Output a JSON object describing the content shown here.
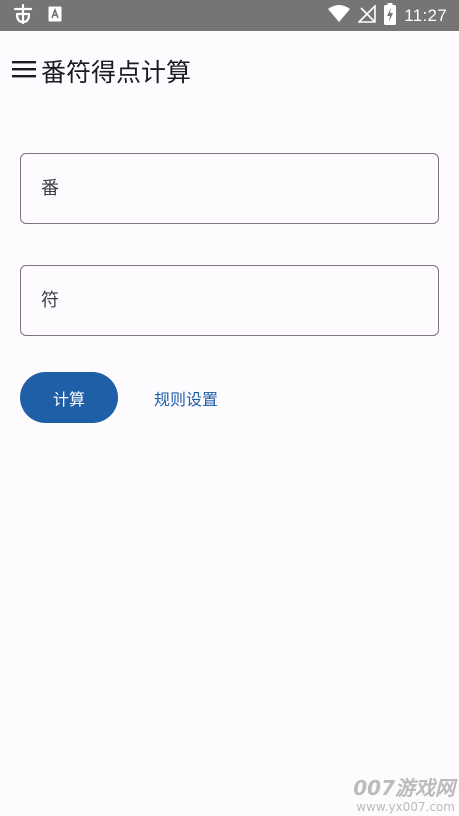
{
  "status_bar": {
    "time": "11:27",
    "icons": [
      "bug-icon",
      "a-notification-icon",
      "wifi-icon",
      "no-signal-icon",
      "battery-charging-icon"
    ]
  },
  "app_bar": {
    "title": "番符得点计算",
    "menu_icon": "hamburger-menu-icon"
  },
  "form": {
    "fan_placeholder": "番",
    "fan_value": "",
    "fu_placeholder": "符",
    "fu_value": "",
    "calculate_label": "计算",
    "rules_label": "规则设置"
  },
  "watermark": {
    "main": "007游戏网",
    "url": "www.yx007.com"
  },
  "colors": {
    "status_bar": "#757575",
    "background": "#fdfbfe",
    "primary": "#1e5fa8",
    "outline": "#79747e"
  }
}
